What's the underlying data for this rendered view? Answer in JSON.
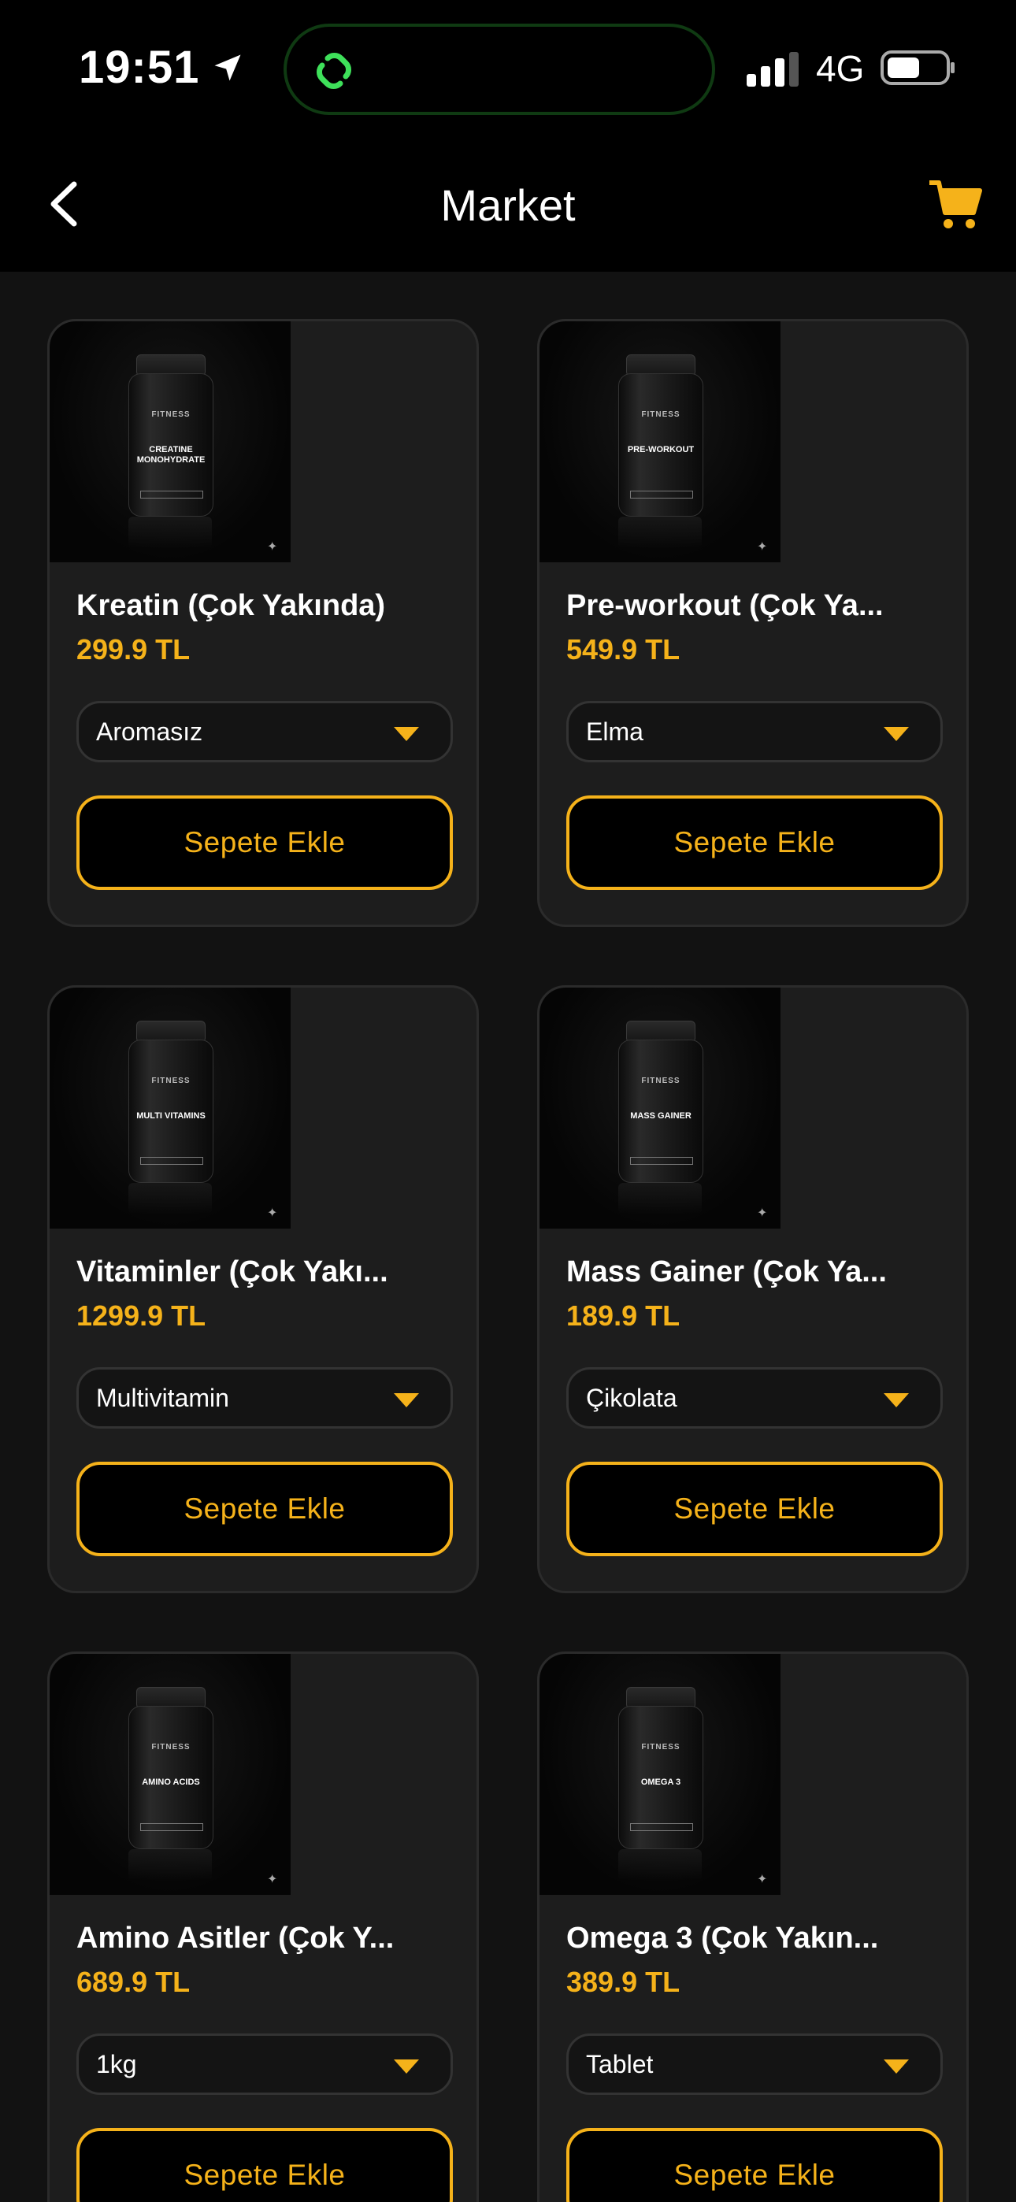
{
  "status": {
    "time": "19:51",
    "network": "4G"
  },
  "nav": {
    "title": "Market"
  },
  "colors": {
    "accent": "#F5B21A",
    "background": "#121212",
    "card": "#1D1D1D"
  },
  "icons": {
    "back": "chevron-left-icon",
    "cart": "cart-icon"
  },
  "products": [
    {
      "name": "Kreatin (Çok Yakında)",
      "price": "299.9 TL",
      "option": "Aromasız",
      "button": "Sepete Ekle",
      "jar_brand": "FITNESS",
      "jar_label": "CREATINE MONOHYDRATE"
    },
    {
      "name": "Pre-workout (Çok Ya...",
      "price": "549.9 TL",
      "option": "Elma",
      "button": "Sepete Ekle",
      "jar_brand": "FITNESS",
      "jar_label": "PRE-WORKOUT"
    },
    {
      "name": "Vitaminler (Çok Yakı...",
      "price": "1299.9 TL",
      "option": "Multivitamin",
      "button": "Sepete Ekle",
      "jar_brand": "FITNESS",
      "jar_label": "MULTI VITAMINS"
    },
    {
      "name": "Mass Gainer (Çok Ya...",
      "price": "189.9 TL",
      "option": "Çikolata",
      "button": "Sepete Ekle",
      "jar_brand": "FITNESS",
      "jar_label": "MASS GAINER"
    },
    {
      "name": "Amino Asitler (Çok Y...",
      "price": "689.9 TL",
      "option": "1kg",
      "button": "Sepete Ekle",
      "jar_brand": "FITNESS",
      "jar_label": "AMINO ACIDS"
    },
    {
      "name": "Omega 3 (Çok Yakın...",
      "price": "389.9 TL",
      "option": "Tablet",
      "button": "Sepete Ekle",
      "jar_brand": "FITNESS",
      "jar_label": "OMEGA 3"
    }
  ]
}
